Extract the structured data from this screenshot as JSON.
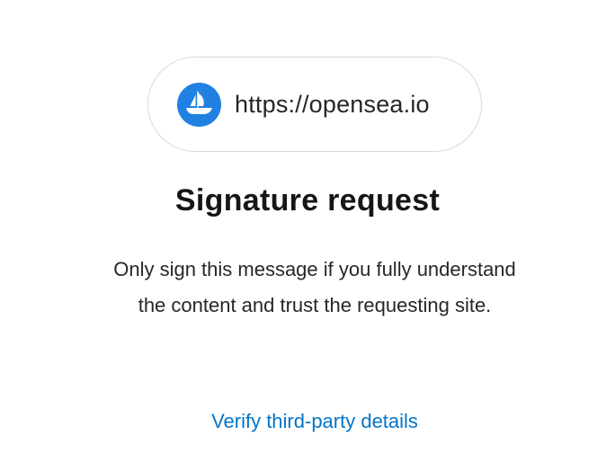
{
  "origin": {
    "url": "https://opensea.io",
    "icon": "opensea-logo-icon",
    "icon_color": "#2081e2"
  },
  "title": "Signature request",
  "description": {
    "line1": "Only sign this message if you fully understand",
    "line2": "the content and trust the requesting site."
  },
  "links": {
    "verify_label": "Verify third-party details",
    "link_color": "#0376c9"
  }
}
